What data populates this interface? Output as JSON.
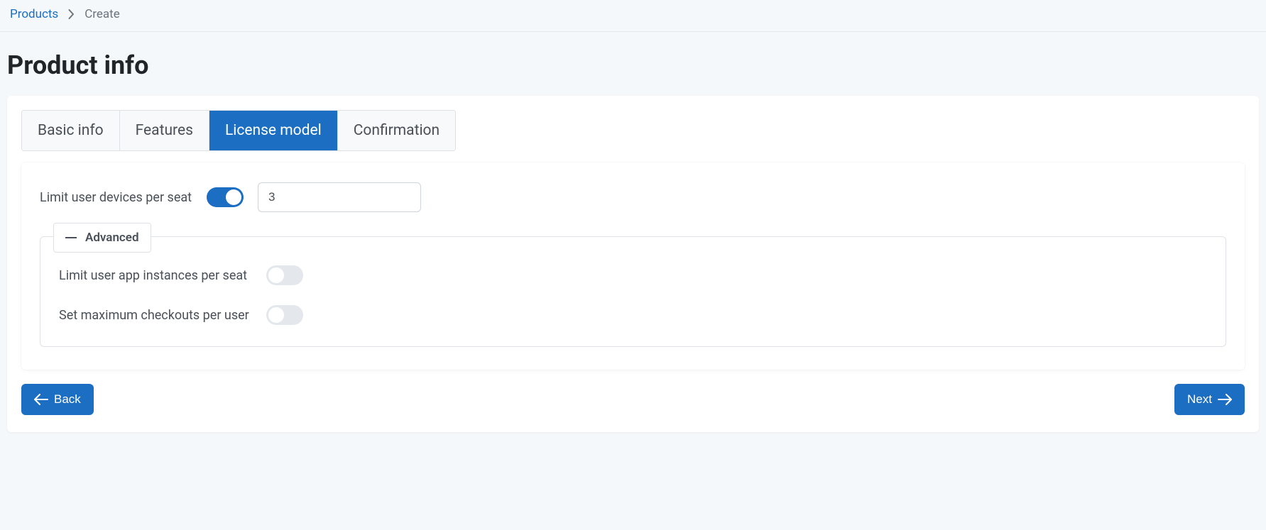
{
  "breadcrumb": {
    "root": "Products",
    "current": "Create"
  },
  "page_title": "Product info",
  "tabs": [
    {
      "label": "Basic info",
      "active": false
    },
    {
      "label": "Features",
      "active": false
    },
    {
      "label": "License model",
      "active": true
    },
    {
      "label": "Confirmation",
      "active": false
    }
  ],
  "form": {
    "limit_devices_label": "Limit user devices per seat",
    "limit_devices_on": true,
    "limit_devices_value": "3",
    "advanced_label": "Advanced",
    "limit_app_instances_label": "Limit user app instances per seat",
    "limit_app_instances_on": false,
    "max_checkouts_label": "Set maximum checkouts per user",
    "max_checkouts_on": false
  },
  "buttons": {
    "back": "Back",
    "next": "Next"
  }
}
